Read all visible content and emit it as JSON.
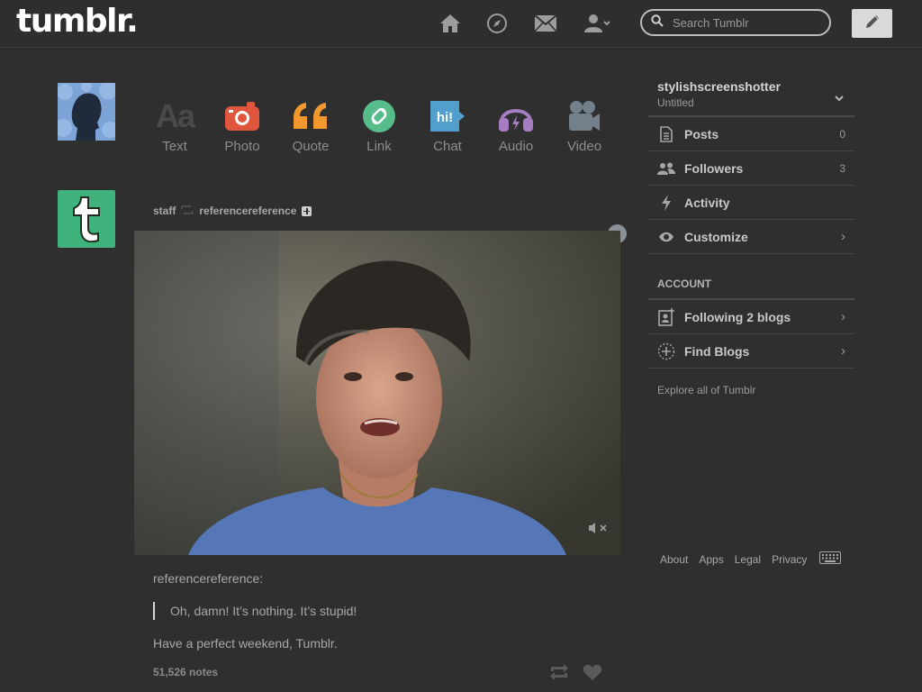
{
  "header": {
    "logo": "tumblr.",
    "search_placeholder": "Search Tumblr"
  },
  "post_types": [
    {
      "label": "Text",
      "icon": "text-icon",
      "color": "#4a4a4a"
    },
    {
      "label": "Photo",
      "icon": "camera-icon",
      "color": "#e0553e"
    },
    {
      "label": "Quote",
      "icon": "quote-icon",
      "color": "#f1992f"
    },
    {
      "label": "Link",
      "icon": "link-icon",
      "color": "#56bc8a"
    },
    {
      "label": "Chat",
      "icon": "chat-icon",
      "color": "#529ecc"
    },
    {
      "label": "Audio",
      "icon": "headphones-icon",
      "color": "#a77dc2"
    },
    {
      "label": "Video",
      "icon": "film-camera-icon",
      "color": "#748089"
    }
  ],
  "post": {
    "author": "staff",
    "reblogged_from": "referencereference",
    "source_name": "referencereference:",
    "quote": "Oh, damn! It’s nothing. It’s stupid!",
    "caption": "Have a perfect weekend, Tumblr.",
    "notes": "51,526 notes"
  },
  "sidebar": {
    "blog_name": "stylishscreenshotter",
    "blog_title": "Untitled",
    "items": [
      {
        "label": "Posts",
        "count": "0",
        "icon": "document-icon"
      },
      {
        "label": "Followers",
        "count": "3",
        "icon": "people-icon"
      },
      {
        "label": "Activity",
        "count": "",
        "icon": "lightning-icon"
      },
      {
        "label": "Customize",
        "count": "",
        "icon": "eye-icon"
      }
    ],
    "account_label": "ACCOUNT",
    "account_items": [
      {
        "label": "Following 2 blogs",
        "icon": "add-person-icon"
      },
      {
        "label": "Find Blogs",
        "icon": "compass-dots-icon"
      }
    ],
    "explore_link": "Explore all of Tumblr"
  },
  "footer": {
    "links": [
      "About",
      "Apps",
      "Legal",
      "Privacy"
    ]
  },
  "colors": {
    "background": "#2f2f2f",
    "staff_avatar": "#3fb37b"
  }
}
